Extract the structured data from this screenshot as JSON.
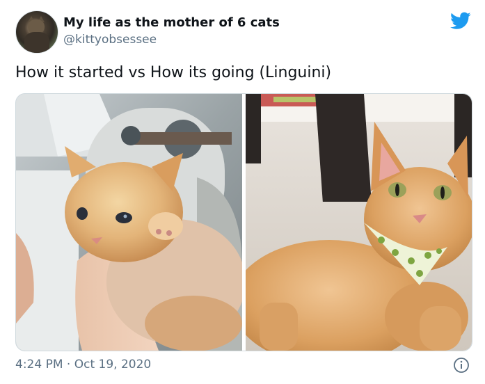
{
  "author": {
    "display_name": "My life as the mother of 6 cats",
    "handle": "@kittyobsessee",
    "avatar_icon": "cat-avatar"
  },
  "tweet": {
    "text": "How it started vs How its going (Linguini)"
  },
  "media": [
    {
      "label": "kitten-photo"
    },
    {
      "label": "cat-bandana-photo"
    }
  ],
  "meta": {
    "time": "4:24 PM",
    "separator": "·",
    "date": "Oct 19, 2020"
  },
  "colors": {
    "brand_blue": "#1d9bf0",
    "text_secondary": "#5b7083",
    "text_primary": "#0f1419",
    "border": "#cfd9de"
  },
  "icons": {
    "brand": "twitter-bird-icon",
    "info": "info-icon"
  }
}
